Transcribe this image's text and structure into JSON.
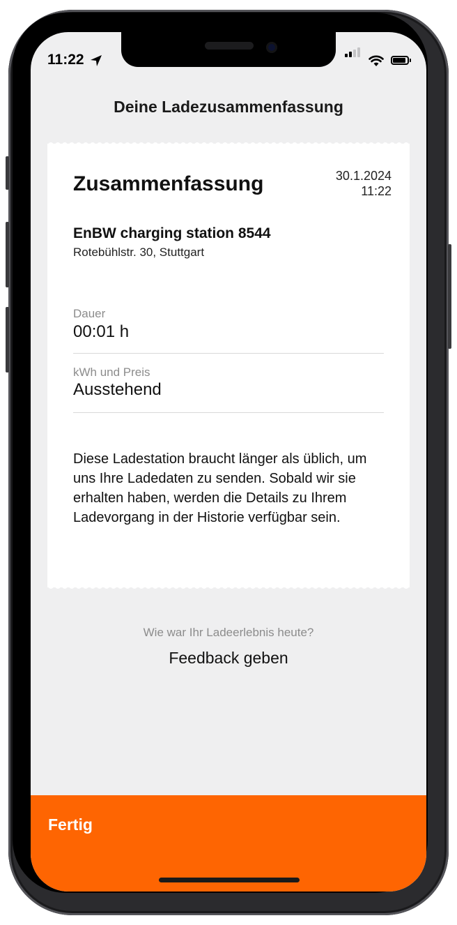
{
  "status_bar": {
    "time": "11:22"
  },
  "header": {
    "title": "Deine Ladezusammenfassung"
  },
  "summary_card": {
    "heading": "Zusammenfassung",
    "date": "30.1.2024",
    "time": "11:22",
    "station_name": "EnBW charging station 8544",
    "station_address": "Rotebühlstr. 30, Stuttgart",
    "fields": [
      {
        "label": "Dauer",
        "value": "00:01 h"
      },
      {
        "label": "kWh und Preis",
        "value": "Ausstehend"
      }
    ],
    "info_text": "Diese Ladestation braucht länger als üblich, um uns Ihre Ladedaten zu senden. Sobald wir sie erhalten haben, werden die Details zu Ihrem Ladevorgang in der Historie verfügbar sein."
  },
  "feedback": {
    "question": "Wie war Ihr Ladeerlebnis heute?",
    "link_label": "Feedback geben"
  },
  "footer": {
    "done_label": "Fertig",
    "accent_color": "#fe6502"
  },
  "icons": [
    "location-arrow-icon",
    "cellular-signal-icon",
    "wifi-icon",
    "battery-icon"
  ]
}
